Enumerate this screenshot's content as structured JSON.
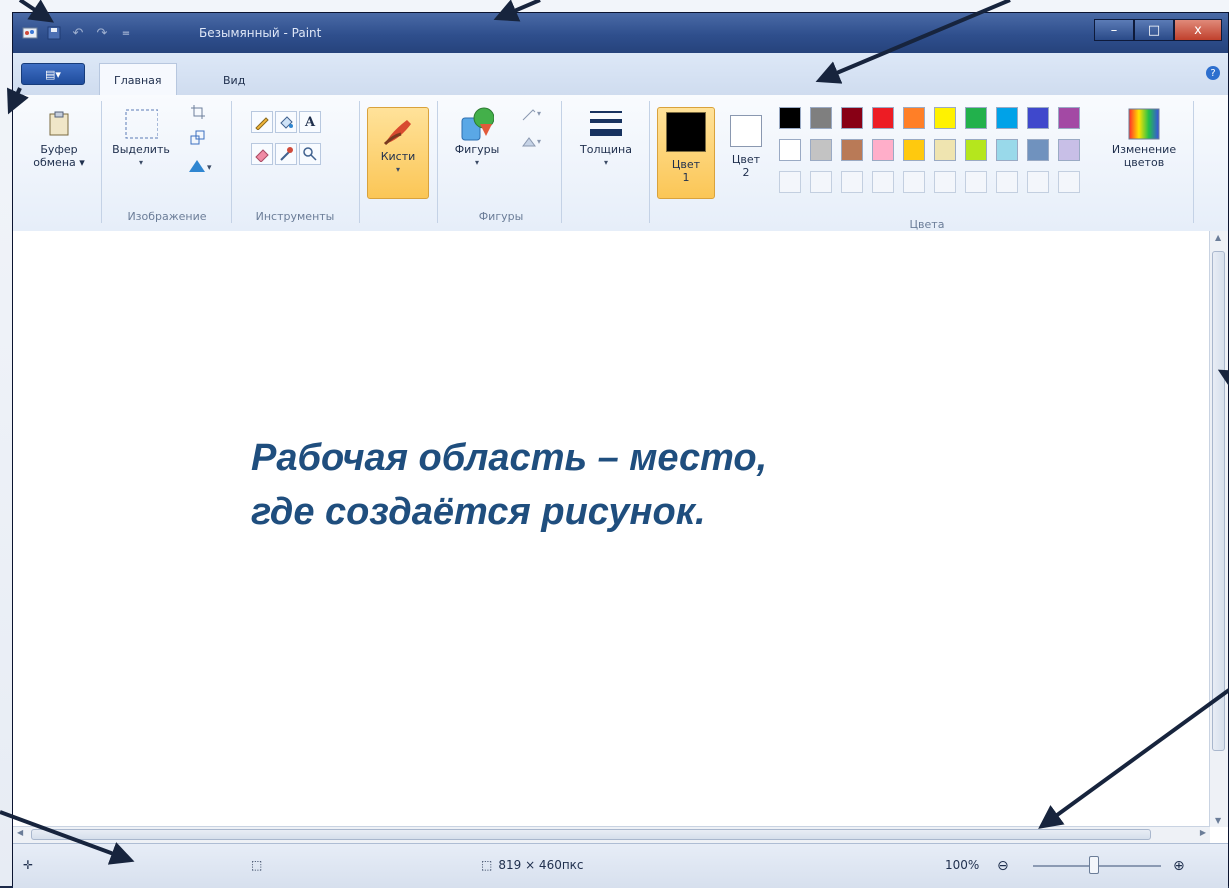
{
  "window": {
    "title": "Безымянный - Paint",
    "controls": {
      "minimize": "–",
      "maximize": "□",
      "close": "x"
    }
  },
  "ribbon_tabs": {
    "app_menu": "▤▾",
    "tabs": [
      "Главная",
      "Вид"
    ],
    "active": "Главная"
  },
  "ribbon": {
    "clipboard": {
      "label_line1": "Буфер",
      "label_line2": "обмена ▾"
    },
    "image": {
      "select": "Выделить",
      "group": "Изображение"
    },
    "tools": {
      "group": "Инструменты"
    },
    "brushes": {
      "label": "Кисти"
    },
    "shapes": {
      "label": "Фигуры",
      "group": "Фигуры"
    },
    "thickness": {
      "label": "Толщина"
    },
    "color1": {
      "label_line1": "Цвет",
      "label_line2": "1"
    },
    "color2": {
      "label_line1": "Цвет",
      "label_line2": "2"
    },
    "edit_colors": {
      "label_line1": "Изменение",
      "label_line2": "цветов"
    },
    "colors_group": "Цвета"
  },
  "palette": {
    "row1": [
      "#000000",
      "#7f7f7f",
      "#880015",
      "#ed1c24",
      "#ff7f27",
      "#fff200",
      "#22b14c",
      "#00a2e8",
      "#3f48cc",
      "#a349a4"
    ],
    "row2": [
      "#ffffff",
      "#c3c3c3",
      "#b97a57",
      "#ffaec9",
      "#ffc90e",
      "#efe4b0",
      "#b5e61d",
      "#99d9ea",
      "#7092be",
      "#c8bfe7"
    ]
  },
  "canvas": {
    "line1": "Рабочая область – место,",
    "line2": "где создаётся рисунок."
  },
  "status": {
    "size": "819 × 460пкс",
    "zoom": "100%",
    "zoom_out": "⊖",
    "zoom_in": "⊕"
  }
}
